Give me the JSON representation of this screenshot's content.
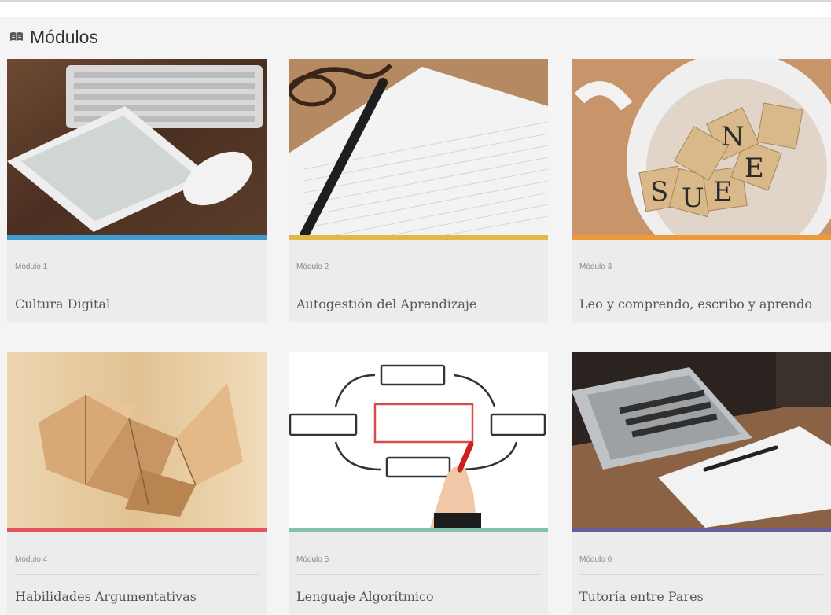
{
  "header": {
    "title": "Módulos",
    "icon": "book-icon"
  },
  "modules": [
    {
      "label": "Módulo 1",
      "title": "Cultura Digital",
      "accent": "#3f9bd0",
      "image": "tablet-keyboard-image"
    },
    {
      "label": "Módulo 2",
      "title": "Autogestión del Aprendizaje",
      "accent": "#e2b84a",
      "image": "notebook-pen-image"
    },
    {
      "label": "Módulo 3",
      "title": "Leo y comprendo, escribo y aprendo",
      "accent": "#ef9a38",
      "image": "letter-tiles-image"
    },
    {
      "label": "Módulo 4",
      "title": "Habilidades Argumentativas",
      "accent": "#e2535e",
      "image": "wooden-blocks-image"
    },
    {
      "label": "Módulo 5",
      "title": "Lenguaje Algorítmico",
      "accent": "#86c0b1",
      "image": "flowchart-image"
    },
    {
      "label": "Módulo 6",
      "title": "Tutoría entre Pares",
      "accent": "#6b5a9c",
      "image": "laptop-desk-image"
    }
  ]
}
